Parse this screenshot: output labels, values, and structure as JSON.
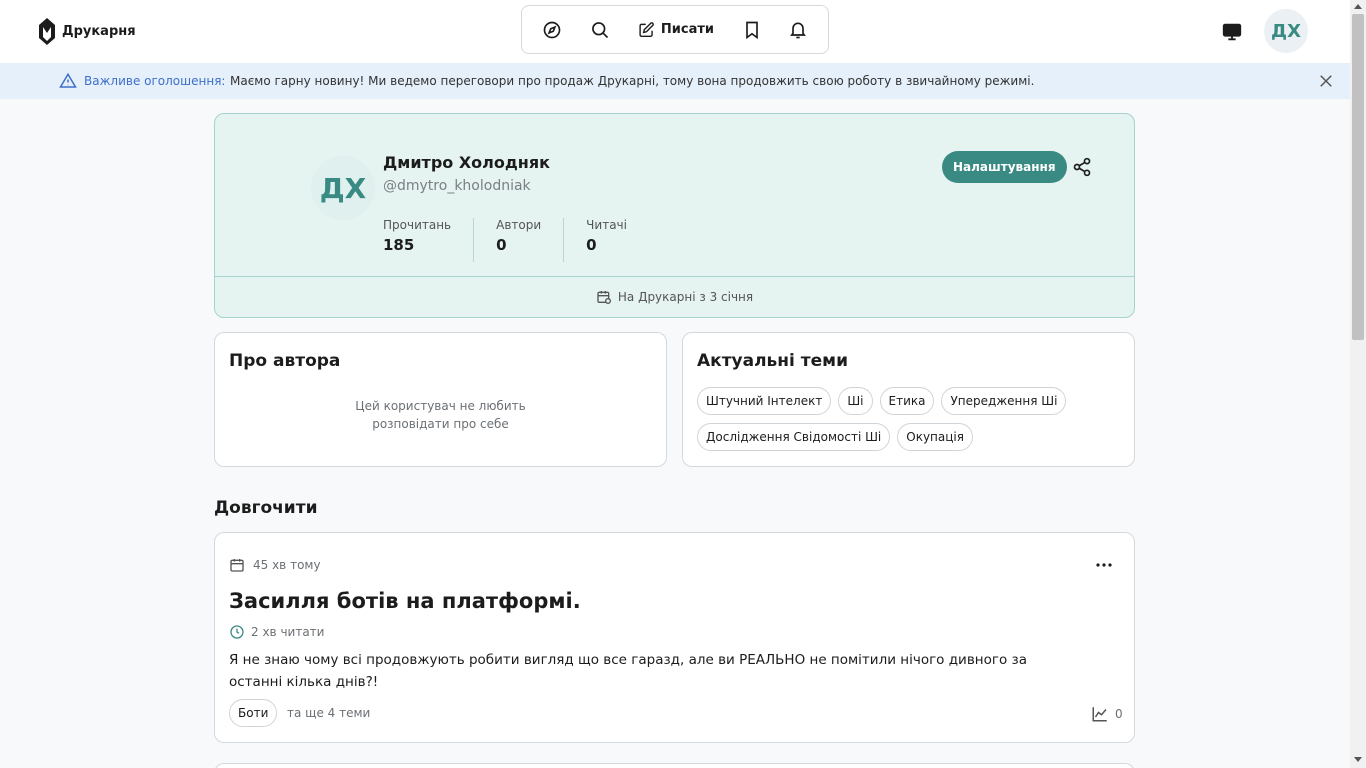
{
  "header": {
    "logo_text": "Друкарня",
    "nav": {
      "write_label": "Писати"
    },
    "avatar_initials": "ДХ"
  },
  "announcement": {
    "label": "Важливе оголошення:",
    "text": "Маємо гарну новину! Ми ведемо переговори про продаж Друкарні, тому вона продовжить свою роботу в звичайному режимі."
  },
  "profile": {
    "avatar_initials": "ДХ",
    "name": "Дмитро Холодняк",
    "handle": "@dmytro_kholodniak",
    "stats": [
      {
        "label": "Прочитань",
        "value": "185"
      },
      {
        "label": "Автори",
        "value": "0"
      },
      {
        "label": "Читачі",
        "value": "0"
      }
    ],
    "settings_label": "Налаштування",
    "joined": "На Друкарні з 3 січня"
  },
  "about": {
    "title": "Про автора",
    "text_line1": "Цей користувач не любить",
    "text_line2": "розповідати про себе"
  },
  "topics": {
    "title": "Актуальні теми",
    "items": [
      "Штучний Інтелект",
      "Ші",
      "Етика",
      "Упередження Ші",
      "Дослідження Свідомості Ші",
      "Окупація"
    ]
  },
  "section_title": "Довгочити",
  "article": {
    "date": "45 хв тому",
    "title": "Засилля ботів на платформі.",
    "read_time": "2 хв читати",
    "text_line1": "Я не знаю чому всі продовжують робити вигляд що все гаразд, але ви РЕАЛЬНО не помітили нічого дивного за",
    "text_line2": "останні кілька днів?!",
    "tag": "Боти",
    "more_topics": "та ще 4 теми",
    "views": "0"
  },
  "colors": {
    "accent": "#3a8a84",
    "announce_bg": "#e6f0fb",
    "announce_text": "#3d6fc9",
    "profile_bg": "#e5f3f1"
  }
}
